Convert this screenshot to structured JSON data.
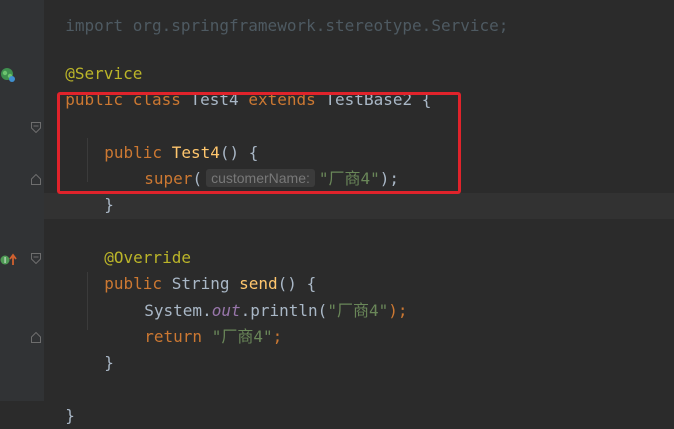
{
  "colors": {
    "background": "#2b2b2b",
    "gutter": "#313335",
    "keyword": "#cc7832",
    "annotation": "#bbb529",
    "function": "#ffc66d",
    "string": "#6a8759",
    "field": "#9876aa",
    "text": "#a9b7c6",
    "highlight_box": "#e0232b"
  },
  "code": {
    "line0": {
      "text": "import org.springframework.stereotype.Service;"
    },
    "line1": {
      "annotation": "@Service"
    },
    "line2": {
      "kw1": "public",
      "kw2": "class",
      "name": "Test4",
      "kw3": "extends",
      "base": "TestBase2",
      "brace": "{"
    },
    "line4": {
      "kw": "public",
      "name": "Test4",
      "rest": "() {"
    },
    "line5": {
      "kw": "super",
      "paren_open": "(",
      "hint": "customerName:",
      "string": "\"厂商4\"",
      "paren_close": ");"
    },
    "line6": {
      "brace": "}"
    },
    "line8": {
      "annotation": "@Override"
    },
    "line9": {
      "kw": "public",
      "type": "String",
      "name": "send",
      "rest": "() {"
    },
    "line10": {
      "cls": "System.",
      "field": "out",
      "call": ".println(",
      "string": "\"厂商4\"",
      "end": ");"
    },
    "line11": {
      "kw": "return",
      "string": "\"厂商4\"",
      "end": ";"
    },
    "line12": {
      "brace": "}"
    },
    "line14": {
      "brace": "}"
    }
  },
  "gutter_icons": {
    "spring_bean": "spring-bean-icon",
    "override": "override-method-icon",
    "fold": "fold-marker-icon"
  }
}
